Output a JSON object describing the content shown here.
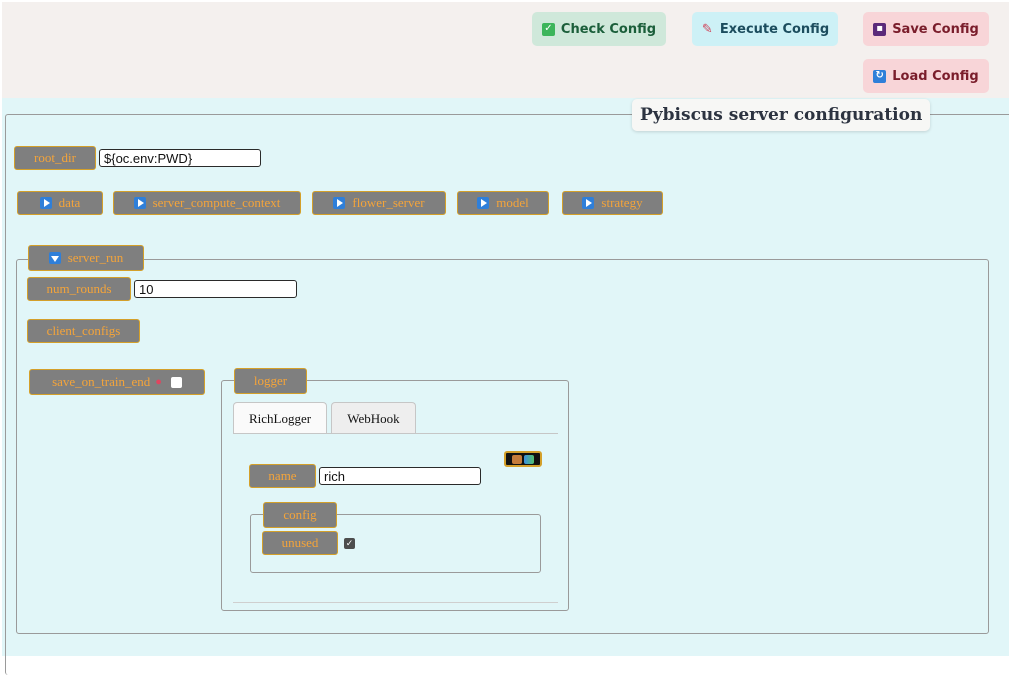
{
  "toolbar": {
    "check_label": "Check Config",
    "execute_label": "Execute Config",
    "save_label": "Save Config",
    "load_label": "Load Config"
  },
  "panel": {
    "title": "Pybiscus server configuration"
  },
  "root_dir": {
    "label": "root_dir",
    "value": "${oc.env:PWD}"
  },
  "sections": [
    {
      "label": "data"
    },
    {
      "label": "server_compute_context"
    },
    {
      "label": "flower_server"
    },
    {
      "label": "model"
    },
    {
      "label": "strategy"
    }
  ],
  "server_run": {
    "label": "server_run",
    "num_rounds": {
      "label": "num_rounds",
      "value": "10"
    },
    "client_configs_label": "client_configs",
    "save_on_train_end": {
      "label": "save_on_train_end",
      "checked": false
    },
    "logger": {
      "label": "logger",
      "tabs": [
        "RichLogger",
        "WebHook"
      ],
      "active_tab": "RichLogger",
      "name": {
        "label": "name",
        "value": "rich"
      },
      "config": {
        "label": "config",
        "unused": {
          "label": "unused",
          "checked": true
        }
      }
    }
  },
  "colors": {
    "accent_label_text": "#f4a43a",
    "label_bg": "#7f7f7f",
    "panel_bg": "#e1f6f8"
  }
}
